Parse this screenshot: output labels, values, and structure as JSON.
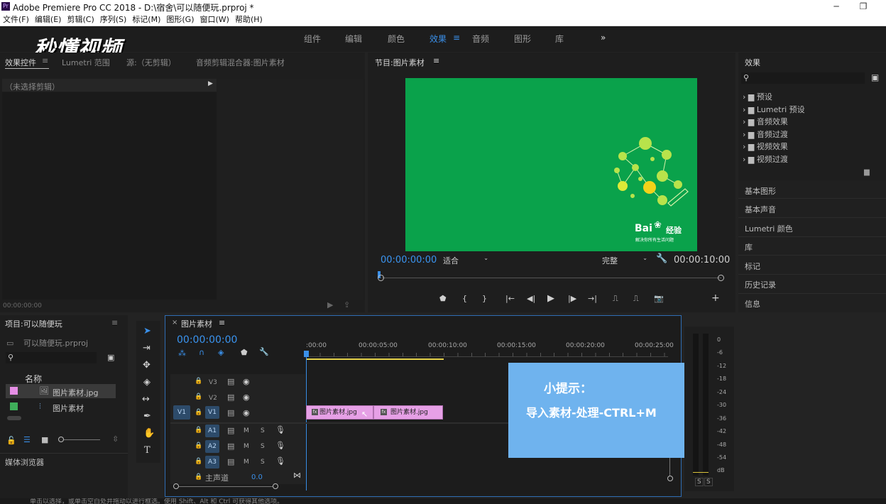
{
  "titlebar": {
    "title": "Adobe Premiere Pro CC 2018 - D:\\宿舍\\可以随便玩.prproj *"
  },
  "menu": [
    "文件(F)",
    "编辑(E)",
    "剪辑(C)",
    "序列(S)",
    "标记(M)",
    "图形(G)",
    "窗口(W)",
    "帮助(H)"
  ],
  "watermark": "秒懂视频",
  "workspaces": [
    "组件",
    "编辑",
    "颜色",
    "效果",
    "音频",
    "图形",
    "库"
  ],
  "effect_controls": {
    "tabs": [
      "效果控件",
      "Lumetri 范围",
      "源:（无剪辑）",
      "音频剪辑混合器:图片素材"
    ],
    "no_clip": "（未选择剪辑）",
    "timecode": "00:00:00:00"
  },
  "program": {
    "title": "节目:图片素材",
    "timecode": "00:00:00:00",
    "fit": "适合",
    "quality": "完整",
    "duration": "00:00:10:00",
    "baidu_brand": "Bai",
    "baidu_jy": "经验",
    "baidu_slogan": "解决你所有生活问题"
  },
  "effects_panel": {
    "title": "效果",
    "items": [
      "预设",
      "Lumetri 预设",
      "音频效果",
      "音频过渡",
      "视频效果",
      "视频过渡"
    ]
  },
  "right_panels": [
    "基本图形",
    "基本声音",
    "Lumetri 颜色",
    "库",
    "标记",
    "历史记录",
    "信息"
  ],
  "project": {
    "title": "项目:可以随便玩",
    "file": "可以随便玩.prproj",
    "col_name": "名称",
    "items": [
      {
        "name": "图片素材.jpg",
        "color": "#e58ee5"
      },
      {
        "name": "图片素材",
        "color": "#3fae5a"
      }
    ],
    "media_browser": "媒体浏览器"
  },
  "timeline": {
    "title": "图片素材",
    "timecode": "00:00:00:00",
    "ruler": [
      ":00:00",
      "00:00:05:00",
      "00:00:10:00",
      "00:00:15:00",
      "00:00:20:00",
      "00:00:25:00"
    ],
    "video_tracks": [
      "V3",
      "V2",
      "V1"
    ],
    "audio_tracks": [
      "A1",
      "A2",
      "A3"
    ],
    "source_v": "V1",
    "master": "主声道",
    "master_val": "0.0",
    "clips": [
      "图片素材.jpg",
      "图片素材.jpg"
    ],
    "ms": [
      "M",
      "S"
    ]
  },
  "tip": {
    "title": "小提示：",
    "text": "导入素材-处理-CTRL+M"
  },
  "meter": {
    "labels": [
      "0",
      "-6",
      "-12",
      "-18",
      "-24",
      "-30",
      "-36",
      "-42",
      "-48",
      "-54",
      "dB"
    ],
    "ss": [
      "S",
      "S"
    ]
  },
  "statusbar": "单击以选择，或单击空白处并拖动以进行框选。使用 Shift、Alt 和 Ctrl 可获得其他选项。"
}
